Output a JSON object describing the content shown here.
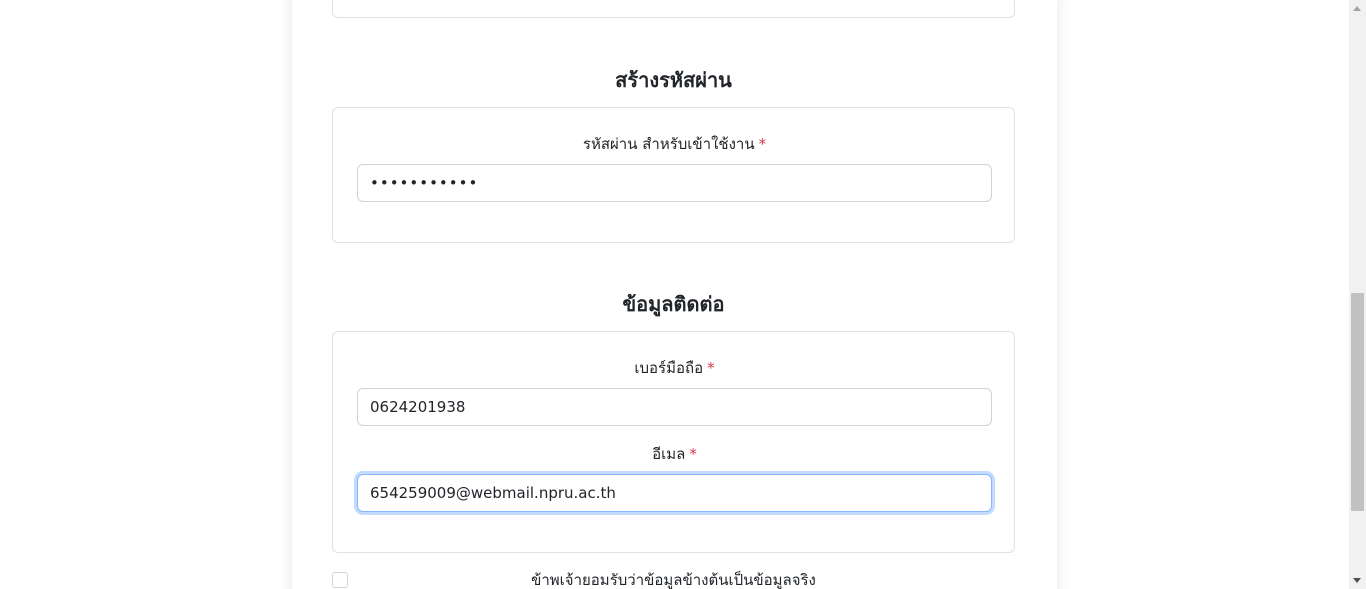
{
  "sections": {
    "password_title": "สร้างรหัสผ่าน",
    "contact_title": "ข้อมูลติดต่อ"
  },
  "fields": {
    "password": {
      "label": "รหัสผ่าน สำหรับเข้าใช้งาน",
      "required_mark": "*",
      "value": "•••••••••••"
    },
    "phone": {
      "label": "เบอร์มือถือ",
      "required_mark": "*",
      "value": "0624201938"
    },
    "email": {
      "label": "อีเมล",
      "required_mark": "*",
      "value": "654259009@webmail.npru.ac.th"
    }
  },
  "consent": {
    "text": "ข้าพเจ้ายอมรับว่าข้อมูลข้างต้นเป็นข้อมูลจริง",
    "checked": false
  },
  "colors": {
    "required": "#dc3545",
    "focus_border": "#86b7fe",
    "border": "#ced4da"
  }
}
